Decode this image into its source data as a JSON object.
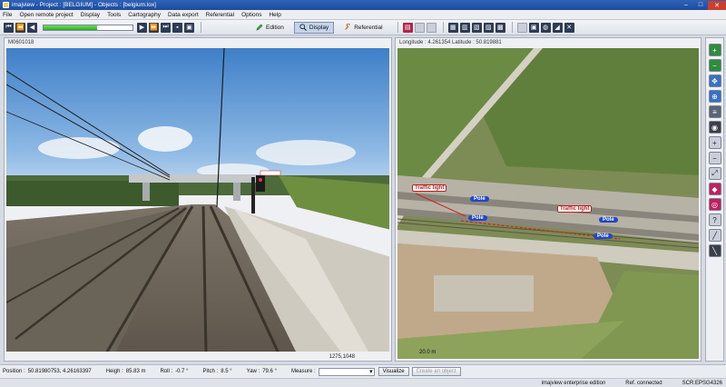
{
  "window": {
    "title": "imajview - Project : [BELGIUM] - Objects : [belgium.lox]"
  },
  "menu": [
    "File",
    "Open remote project",
    "Display",
    "Tools",
    "Cartography",
    "Data export",
    "Referential",
    "Options",
    "Help"
  ],
  "toolbar": {
    "progress": 0.6,
    "edition_label": "Edition",
    "display_label": "Display",
    "referential_label": "Referential"
  },
  "left_pane": {
    "frame_id": "M0601018",
    "pixel_coords": "1275,1048"
  },
  "right_pane": {
    "coords": "Longitude : 4.261354 Latitude : 50.819881",
    "scale": "20.0 m",
    "labels": {
      "traffic_light_1": "Traffic light",
      "traffic_light_2": "Traffic light",
      "pole_1": "Pole",
      "pole_2": "Pole",
      "pole_3": "Pole",
      "pole_4": "Pole"
    }
  },
  "status": {
    "position_label": "Position :",
    "position_value": "50.81980753, 4.26163397",
    "height_label": "Heigh :",
    "height_value": "85.83 m",
    "roll_label": "Roll :",
    "roll_value": "-0.7 °",
    "pitch_label": "Pitch :",
    "pitch_value": "8.5 °",
    "yaw_label": "Yaw :",
    "yaw_value": "79.6 °",
    "measure_label": "Measure :",
    "measure_value": "",
    "visualize_label": "Visualize",
    "create_label": "Create an object"
  },
  "footer": {
    "edition": "imajview enterprise edition",
    "ref": "Ref. connected",
    "scr": "SCR:EPSG4326"
  }
}
